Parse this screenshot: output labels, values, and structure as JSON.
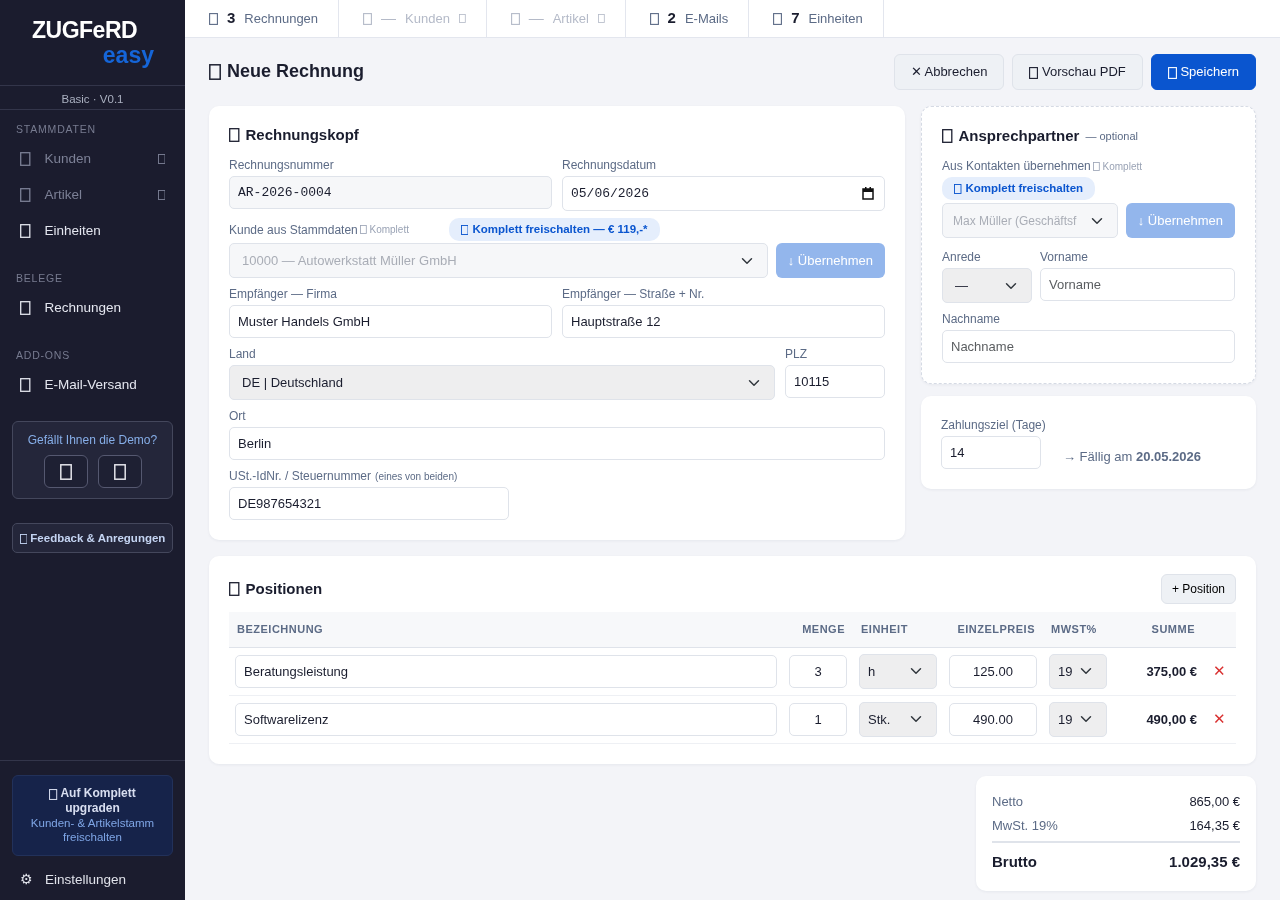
{
  "sidebar": {
    "logo": {
      "title": "ZUGFeRD",
      "subtitle": "easy"
    },
    "edition": "Basic",
    "separator": "·",
    "version": "V0.1",
    "sections": [
      {
        "title": "STAMMDATEN",
        "items": [
          {
            "label": "Kunden",
            "disabled": true,
            "locked": true
          },
          {
            "label": "Artikel",
            "disabled": true,
            "locked": true
          },
          {
            "label": "Einheiten",
            "disabled": false,
            "locked": false
          }
        ]
      },
      {
        "title": "BELEGE",
        "items": [
          {
            "label": "Rechnungen",
            "disabled": false,
            "locked": false
          }
        ]
      },
      {
        "title": "ADD-ONS",
        "items": [
          {
            "label": "E-Mail-Versand",
            "disabled": false,
            "locked": false
          }
        ]
      }
    ],
    "demo": {
      "question": "Gefällt Ihnen die Demo?"
    },
    "feedback_button": "Feedback & Anregungen",
    "upgrade": {
      "title": "Auf Komplett upgraden",
      "subtitle": "Kunden- & Artikelstamm freischalten"
    },
    "settings": {
      "icon": "⚙",
      "label": "Einstellungen"
    }
  },
  "stats": [
    {
      "count": "3",
      "label": "Rechnungen",
      "disabled": false,
      "locked": false
    },
    {
      "count": "—",
      "label": "Kunden",
      "disabled": true,
      "locked": true
    },
    {
      "count": "—",
      "label": "Artikel",
      "disabled": true,
      "locked": true
    },
    {
      "count": "2",
      "label": "E-Mails",
      "disabled": false,
      "locked": false
    },
    {
      "count": "7",
      "label": "Einheiten",
      "disabled": false,
      "locked": false
    }
  ],
  "page_title": "Neue Rechnung",
  "actions": [
    {
      "label": "✕ Abbrechen",
      "kind": "secondary",
      "icon": false
    },
    {
      "label": "Vorschau PDF",
      "kind": "secondary",
      "icon": true
    },
    {
      "label": "Speichern",
      "kind": "primary",
      "icon": true
    }
  ],
  "invoice_header": {
    "title": "Rechnungskopf",
    "invoice_number": {
      "label": "Rechnungsnummer",
      "value": "AR-2026-0004"
    },
    "invoice_date": {
      "label": "Rechnungsdatum",
      "value": "05/06/2026"
    },
    "customer": {
      "label": "Kunde aus Stammdaten",
      "lock_note": "Komplett",
      "value": "10000 — Autowerkstatt Müller GmbH",
      "disabled": true,
      "promo": "Komplett freischalten — € 119,-*",
      "button": "↓ Übernehmen"
    },
    "company": {
      "label": "Empfänger — Firma",
      "value": "Muster Handels GmbH"
    },
    "street": {
      "label": "Empfänger — Straße + Nr.",
      "value": "Hauptstraße 12"
    },
    "country": {
      "label": "Land",
      "value": "DE | Deutschland"
    },
    "zip": {
      "label": "PLZ",
      "value": "10115"
    },
    "city": {
      "label": "Ort",
      "value": "Berlin"
    },
    "vat_id": {
      "label": "USt.-IdNr. / Steuernummer",
      "hint": "(eines von beiden)",
      "value": "DE987654321"
    }
  },
  "contact": {
    "title": "Ansprechpartner",
    "optional": "— optional",
    "import": {
      "label": "Aus Kontakten übernehmen",
      "lock_note": "Komplett",
      "value": "Max Müller (Geschäftsf",
      "disabled": true,
      "promo": "Komplett freischalten",
      "button": "↓ Übernehmen"
    },
    "salutation": {
      "label": "Anrede",
      "value": "—"
    },
    "first_name": {
      "label": "Vorname",
      "placeholder": "Vorname"
    },
    "last_name": {
      "label": "Nachname",
      "placeholder": "Nachname"
    }
  },
  "payment": {
    "label": "Zahlungsziel (Tage)",
    "value": "14",
    "due": "→ Fällig am **20.05.2026**"
  },
  "positions": {
    "title": "Positionen",
    "add_button": "+ Position",
    "columns": [
      "BEZEICHNUNG",
      "MENGE",
      "EINHEIT",
      "EINZELPREIS",
      "MWST%",
      "SUMME"
    ],
    "rows": [
      {
        "description": "Beratungsleistung",
        "quantity": "3",
        "unit": "h",
        "price": "125.00",
        "vat": "19",
        "total": "375,00 €",
        "remove": "✕"
      },
      {
        "description": "Softwarelizenz",
        "quantity": "1",
        "unit": "Stk.",
        "price": "490.00",
        "vat": "19",
        "total": "490,00 €",
        "remove": "✕"
      }
    ]
  },
  "totals": {
    "rows": [
      {
        "label": "Netto",
        "value": "865,00 €"
      },
      {
        "label": "MwSt. 19%",
        "value": "164,35 €"
      }
    ],
    "gross": {
      "label": "Brutto",
      "value": "1.029,35 €"
    }
  }
}
